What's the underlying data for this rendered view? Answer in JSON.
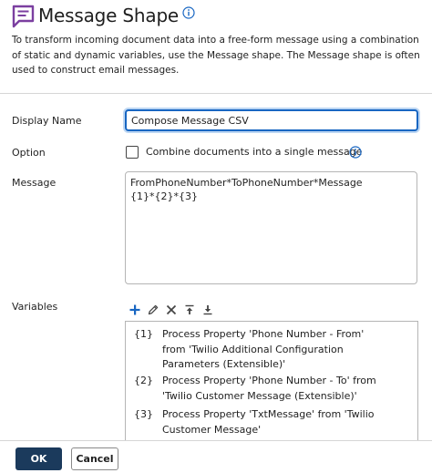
{
  "header": {
    "title": "Message Shape",
    "title_icon": "message-square-icon",
    "description": "To transform incoming document data into a free-form message using a combination of static and dynamic variables, use the Message shape. The Message shape is often used to construct email messages."
  },
  "form": {
    "display_name_label": "Display Name",
    "display_name_value": "Compose Message CSV",
    "option_label": "Option",
    "option_checkbox_label": "Combine documents into a single message",
    "option_checked": false,
    "message_label": "Message",
    "message_value": "FromPhoneNumber*ToPhoneNumber*Message\n{1}*{2}*{3}",
    "variables_label": "Variables"
  },
  "toolbar": {
    "icons": [
      "plus-icon",
      "pencil-icon",
      "close-icon",
      "move-up-icon",
      "move-down-icon"
    ]
  },
  "variables": [
    {
      "key": "{1}",
      "text": "Process Property 'Phone Number - From' from 'Twilio Additional Configuration Parameters (Extensible)'"
    },
    {
      "key": "{2}",
      "text": "Process Property 'Phone Number - To' from 'Twilio Customer Message (Extensible)'"
    },
    {
      "key": "{3}",
      "text": "Process Property 'TxtMessage' from 'Twilio Customer Message'"
    }
  ],
  "footer": {
    "ok_label": "OK",
    "cancel_label": "Cancel"
  },
  "colors": {
    "accent": "#7b3fa0",
    "info": "#1866c2",
    "primary_button": "#1b3a5c",
    "plus": "#1866c2"
  }
}
